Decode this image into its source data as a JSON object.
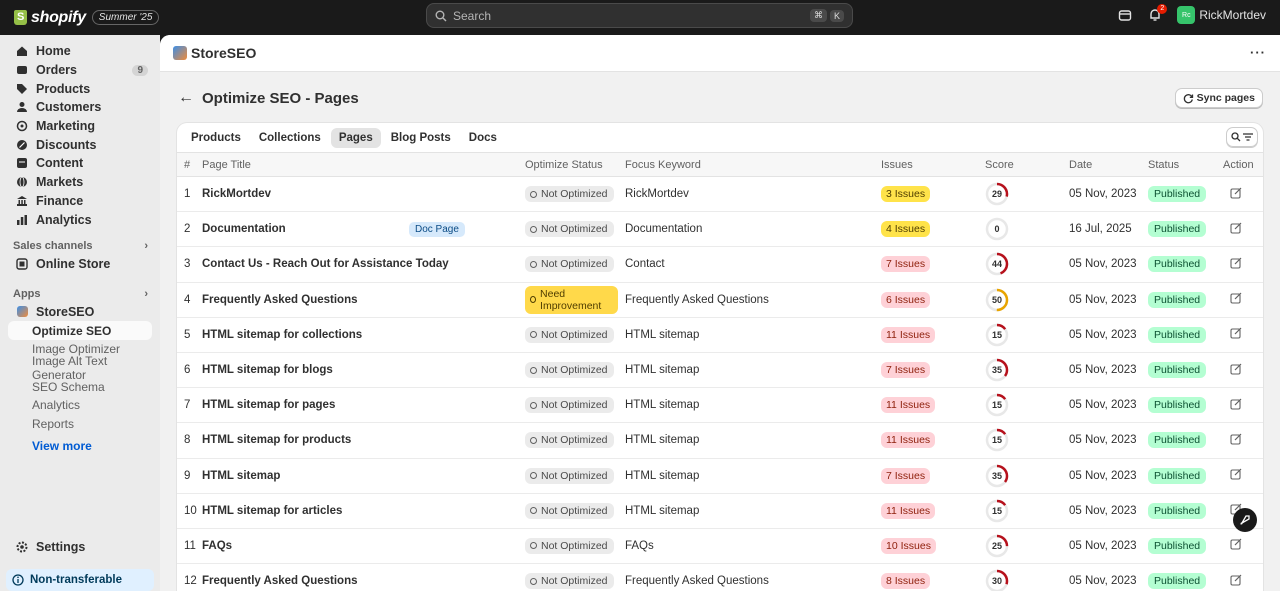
{
  "topbar": {
    "brand": "shopify",
    "edition": "Summer '25",
    "search_placeholder": "Search",
    "kbd1": "⌘",
    "kbd2": "K",
    "notif_count": "2",
    "avatar_initials": "Rc",
    "user_name": "RickMortdev"
  },
  "sidebar": {
    "nav": [
      {
        "label": "Home",
        "icon": "home-icon"
      },
      {
        "label": "Orders",
        "icon": "orders-icon",
        "count": "9"
      },
      {
        "label": "Products",
        "icon": "tag-icon"
      },
      {
        "label": "Customers",
        "icon": "person-icon"
      },
      {
        "label": "Marketing",
        "icon": "target-icon"
      },
      {
        "label": "Discounts",
        "icon": "discount-icon"
      },
      {
        "label": "Content",
        "icon": "content-icon"
      },
      {
        "label": "Markets",
        "icon": "globe-icon"
      },
      {
        "label": "Finance",
        "icon": "bank-icon"
      },
      {
        "label": "Analytics",
        "icon": "chart-icon"
      }
    ],
    "sales_channels_label": "Sales channels",
    "online_store": "Online Store",
    "apps_label": "Apps",
    "app_name": "StoreSEO",
    "sub_items": [
      "Optimize SEO",
      "Image Optimizer",
      "Image Alt Text Generator",
      "SEO Schema",
      "Analytics",
      "Reports"
    ],
    "view_more": "View more",
    "settings": "Settings",
    "non_transferable": "Non-transferable"
  },
  "app": {
    "name": "StoreSEO",
    "page_title": "Optimize SEO - Pages",
    "sync_label": "Sync pages"
  },
  "tabs": [
    "Products",
    "Collections",
    "Pages",
    "Blog Posts",
    "Docs"
  ],
  "columns": {
    "num": "#",
    "title": "Page Title",
    "optimize": "Optimize Status",
    "keyword": "Focus Keyword",
    "issues": "Issues",
    "score": "Score",
    "date": "Date",
    "status": "Status",
    "action": "Action"
  },
  "rows": [
    {
      "num": "1",
      "title": "RickMortdev",
      "badge": "",
      "optimize": "Not Optimized",
      "keyword": "RickMortdev",
      "issues": "3 Issues",
      "issue_color": "yellow",
      "score": 29,
      "date": "05 Nov, 2023",
      "status": "Published"
    },
    {
      "num": "2",
      "title": "Documentation",
      "badge": "Doc Page",
      "optimize": "Not Optimized",
      "keyword": "Documentation",
      "issues": "4 Issues",
      "issue_color": "yellow",
      "score": 0,
      "date": "16 Jul, 2025",
      "status": "Published"
    },
    {
      "num": "3",
      "title": "Contact Us - Reach Out for Assistance Today",
      "badge": "",
      "optimize": "Not Optimized",
      "keyword": "Contact",
      "issues": "7 Issues",
      "issue_color": "red",
      "score": 44,
      "date": "05 Nov, 2023",
      "status": "Published"
    },
    {
      "num": "4",
      "title": "Frequently Asked Questions",
      "badge": "",
      "optimize": "Need Improvement",
      "keyword": "Frequently Asked Questions",
      "issues": "6 Issues",
      "issue_color": "red",
      "score": 50,
      "date": "05 Nov, 2023",
      "status": "Published"
    },
    {
      "num": "5",
      "title": "HTML sitemap for collections",
      "badge": "",
      "optimize": "Not Optimized",
      "keyword": "HTML sitemap",
      "issues": "11 Issues",
      "issue_color": "red",
      "score": 15,
      "date": "05 Nov, 2023",
      "status": "Published"
    },
    {
      "num": "6",
      "title": "HTML sitemap for blogs",
      "badge": "",
      "optimize": "Not Optimized",
      "keyword": "HTML sitemap",
      "issues": "7 Issues",
      "issue_color": "red",
      "score": 35,
      "date": "05 Nov, 2023",
      "status": "Published"
    },
    {
      "num": "7",
      "title": "HTML sitemap for pages",
      "badge": "",
      "optimize": "Not Optimized",
      "keyword": "HTML sitemap",
      "issues": "11 Issues",
      "issue_color": "red",
      "score": 15,
      "date": "05 Nov, 2023",
      "status": "Published"
    },
    {
      "num": "8",
      "title": "HTML sitemap for products",
      "badge": "",
      "optimize": "Not Optimized",
      "keyword": "HTML sitemap",
      "issues": "11 Issues",
      "issue_color": "red",
      "score": 15,
      "date": "05 Nov, 2023",
      "status": "Published"
    },
    {
      "num": "9",
      "title": "HTML sitemap",
      "badge": "",
      "optimize": "Not Optimized",
      "keyword": "HTML sitemap",
      "issues": "7 Issues",
      "issue_color": "red",
      "score": 35,
      "date": "05 Nov, 2023",
      "status": "Published"
    },
    {
      "num": "10",
      "title": "HTML sitemap for articles",
      "badge": "",
      "optimize": "Not Optimized",
      "keyword": "HTML sitemap",
      "issues": "11 Issues",
      "issue_color": "red",
      "score": 15,
      "date": "05 Nov, 2023",
      "status": "Published"
    },
    {
      "num": "11",
      "title": "FAQs",
      "badge": "",
      "optimize": "Not Optimized",
      "keyword": "FAQs",
      "issues": "10 Issues",
      "issue_color": "red",
      "score": 25,
      "date": "05 Nov, 2023",
      "status": "Published"
    },
    {
      "num": "12",
      "title": "Frequently Asked Questions",
      "badge": "",
      "optimize": "Not Optimized",
      "keyword": "Frequently Asked Questions",
      "issues": "8 Issues",
      "issue_color": "red",
      "score": 30,
      "date": "05 Nov, 2023",
      "status": "Published"
    }
  ],
  "colors": {
    "score_red": "#b6111c",
    "score_yellow": "#e8a400",
    "track": "#e8e8e8"
  }
}
